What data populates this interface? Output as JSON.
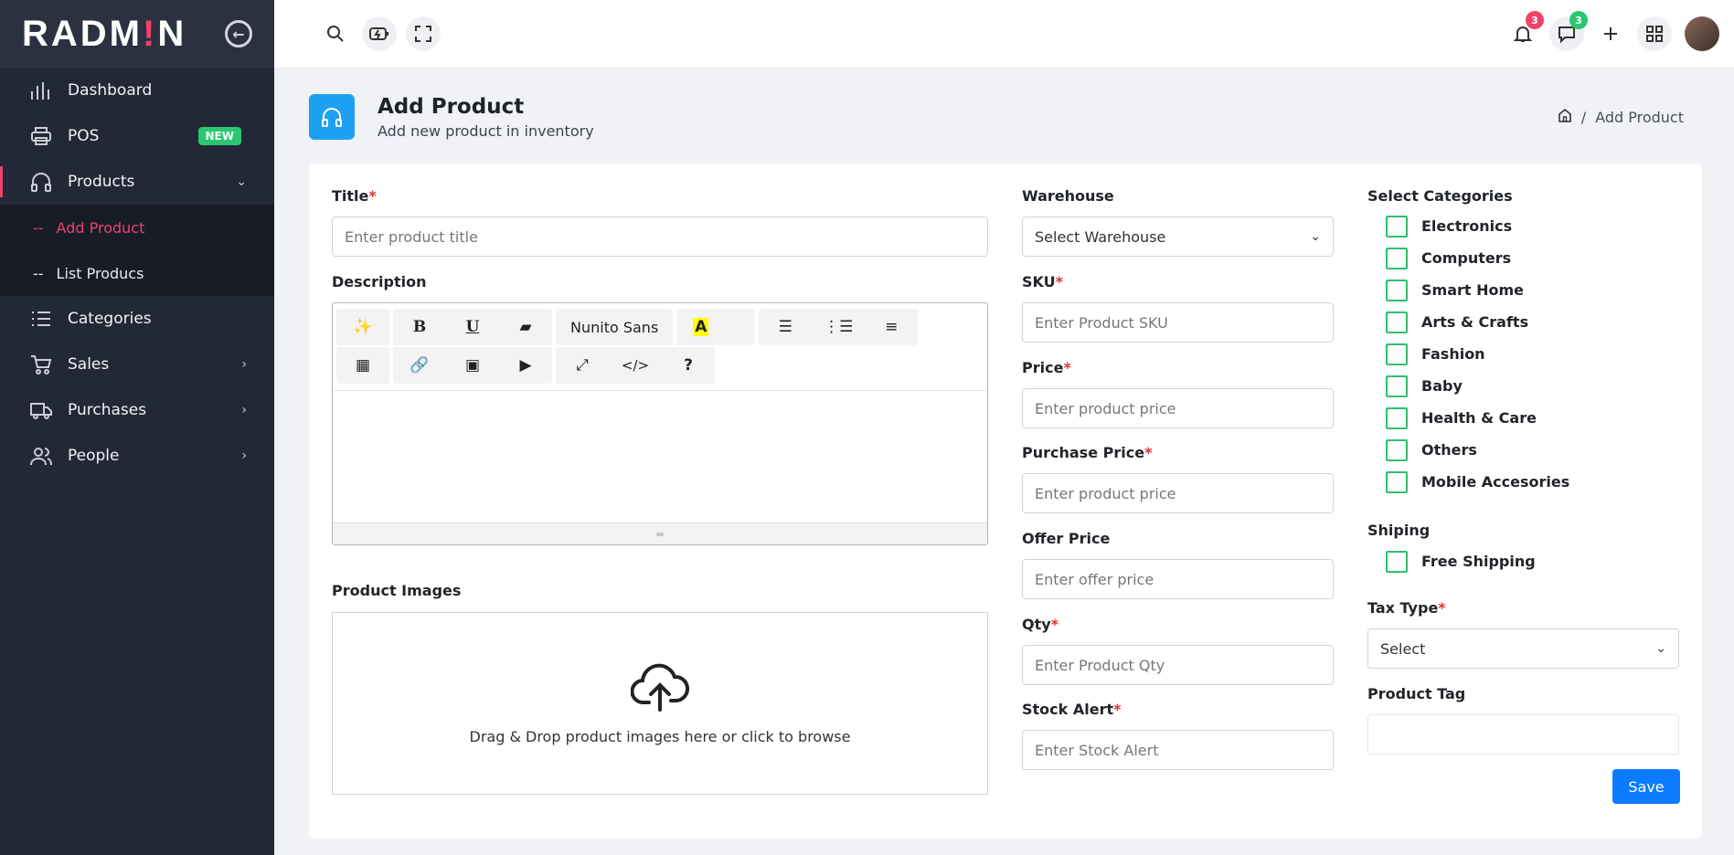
{
  "sidebar": {
    "logo": {
      "part1": "RADM",
      "dot": "!",
      "part2": "N"
    },
    "items": [
      {
        "label": "Dashboard"
      },
      {
        "label": "POS",
        "badge": "NEW"
      },
      {
        "label": "Products"
      },
      {
        "label": "Categories"
      },
      {
        "label": "Sales"
      },
      {
        "label": "Purchases"
      },
      {
        "label": "People"
      }
    ],
    "sub_items": [
      {
        "label": "Add Product"
      },
      {
        "label": "List Producs"
      }
    ]
  },
  "topbar": {
    "notifications_count": "3",
    "messages_count": "3"
  },
  "page": {
    "title": "Add Product",
    "subtitle": "Add new product in inventory",
    "breadcrumb_current": "Add Product"
  },
  "form": {
    "title_label": "Title",
    "title_placeholder": "Enter product title",
    "description_label": "Description",
    "editor_font": "Nunito Sans",
    "images_label": "Product Images",
    "dropzone_text": "Drag & Drop product images here or click to browse",
    "warehouse_label": "Warehouse",
    "warehouse_value": "Select Warehouse",
    "sku_label": "SKU",
    "sku_placeholder": "Enter Product SKU",
    "price_label": "Price",
    "price_placeholder": "Enter product price",
    "purchase_price_label": "Purchase Price",
    "purchase_price_placeholder": "Enter product price",
    "offer_price_label": "Offer Price",
    "offer_price_placeholder": "Enter offer price",
    "qty_label": "Qty",
    "qty_placeholder": "Enter Product Qty",
    "stock_alert_label": "Stock Alert",
    "stock_alert_placeholder": "Enter Stock Alert",
    "categories_label": "Select Categories",
    "categories": [
      "Electronics",
      "Computers",
      "Smart Home",
      "Arts & Crafts",
      "Fashion",
      "Baby",
      "Health & Care",
      "Others",
      "Mobile Accesories"
    ],
    "shipping_label": "Shiping",
    "free_shipping_label": "Free Shipping",
    "tax_type_label": "Tax Type",
    "tax_type_value": "Select",
    "product_tag_label": "Product Tag",
    "save_label": "Save"
  },
  "colors": {
    "accent": "#f1416c",
    "primary": "#0d7bff",
    "success": "#29c76f",
    "info": "#1da1f2"
  }
}
